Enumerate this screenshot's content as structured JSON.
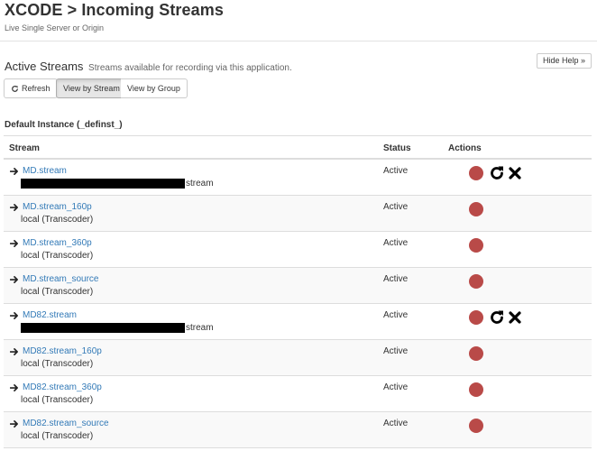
{
  "header": {
    "title": "XCODE > Incoming Streams",
    "subtitle": "Live Single Server or Origin",
    "hide_help_label": "Hide Help »"
  },
  "section": {
    "title": "Active Streams",
    "description": "Streams available for recording via this application."
  },
  "toolbar": {
    "refresh_label": "Refresh",
    "view_by_stream_label": "View by Stream",
    "view_by_group_label": "View by Group"
  },
  "instance": {
    "title": "Default Instance (_definst_)"
  },
  "table": {
    "columns": {
      "stream": "Stream",
      "status": "Status",
      "actions": "Actions"
    },
    "rows": [
      {
        "name": "MD.stream",
        "origin": "stream",
        "origin_redacted": true,
        "status": "Active",
        "extra_actions": true
      },
      {
        "name": "MD.stream_160p",
        "origin": "local (Transcoder)",
        "origin_redacted": false,
        "status": "Active",
        "extra_actions": false
      },
      {
        "name": "MD.stream_360p",
        "origin": "local (Transcoder)",
        "origin_redacted": false,
        "status": "Active",
        "extra_actions": false
      },
      {
        "name": "MD.stream_source",
        "origin": "local (Transcoder)",
        "origin_redacted": false,
        "status": "Active",
        "extra_actions": false
      },
      {
        "name": "MD82.stream",
        "origin": "stream",
        "origin_redacted": true,
        "status": "Active",
        "extra_actions": true
      },
      {
        "name": "MD82.stream_160p",
        "origin": "local (Transcoder)",
        "origin_redacted": false,
        "status": "Active",
        "extra_actions": false
      },
      {
        "name": "MD82.stream_360p",
        "origin": "local (Transcoder)",
        "origin_redacted": false,
        "status": "Active",
        "extra_actions": false
      },
      {
        "name": "MD82.stream_source",
        "origin": "local (Transcoder)",
        "origin_redacted": false,
        "status": "Active",
        "extra_actions": false
      }
    ]
  },
  "colors": {
    "link": "#337ab7",
    "record_dot": "#b94a48",
    "row_stripe": "#f9f9f9"
  },
  "icons": {
    "row_arrow": "arrow-right-icon",
    "record": "record-icon",
    "reset": "reset-icon",
    "remove": "remove-icon",
    "refresh": "refresh-icon"
  }
}
